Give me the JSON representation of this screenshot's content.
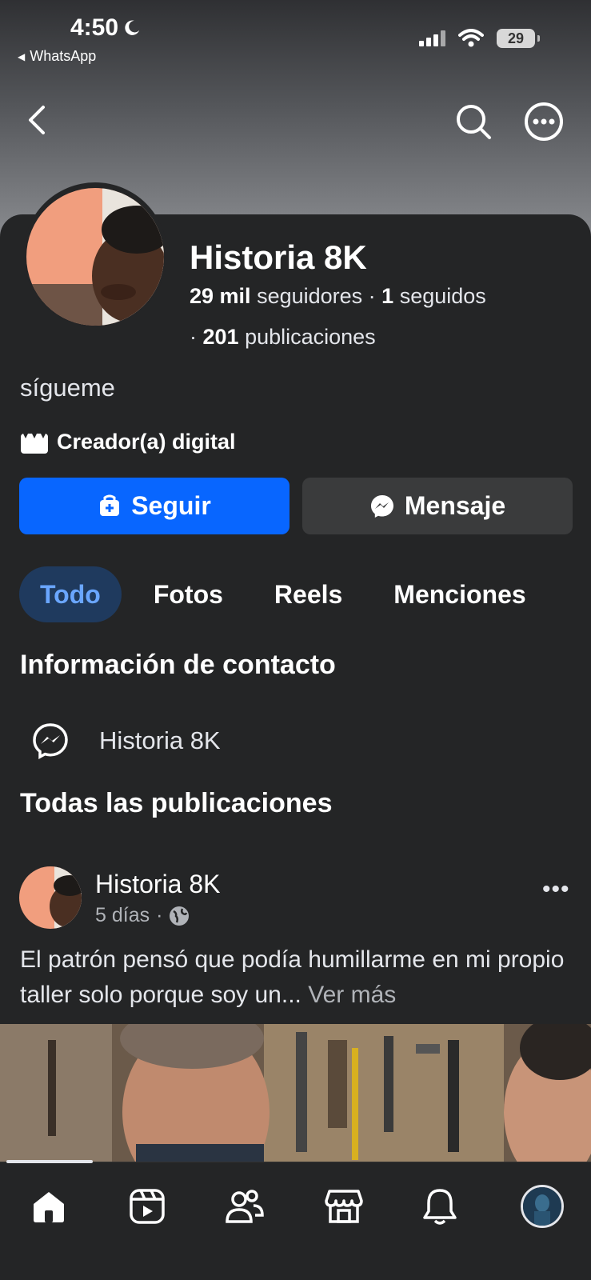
{
  "status_bar": {
    "time": "4:50",
    "back_app": "WhatsApp",
    "battery": "29"
  },
  "profile": {
    "name": "Historia 8K",
    "followers_count": "29 mil",
    "followers_label": "seguidores",
    "following_count": "1",
    "following_label": "seguidos",
    "posts_count": "201",
    "posts_label": "publicaciones",
    "bio": "sígueme",
    "category": "Creador(a) digital"
  },
  "actions": {
    "follow_label": "Seguir",
    "message_label": "Mensaje"
  },
  "tabs": [
    {
      "label": "Todo",
      "active": true
    },
    {
      "label": "Fotos",
      "active": false
    },
    {
      "label": "Reels",
      "active": false
    },
    {
      "label": "Menciones",
      "active": false
    }
  ],
  "contact": {
    "title": "Información de contacto",
    "messenger_name": "Historia 8K"
  },
  "posts_section": {
    "title": "Todas las publicaciones"
  },
  "post": {
    "author": "Historia 8K",
    "time": "5 días",
    "text": "El patrón pensó que podía humillarme en mi propio taller solo porque soy un...",
    "see_more": "Ver más"
  },
  "bottom_nav": [
    {
      "icon": "home-icon",
      "active": true
    },
    {
      "icon": "reels-icon",
      "active": false
    },
    {
      "icon": "friends-icon",
      "active": false
    },
    {
      "icon": "marketplace-icon",
      "active": false
    },
    {
      "icon": "bell-icon",
      "active": false
    },
    {
      "icon": "profile-avatar-icon",
      "active": false
    }
  ],
  "colors": {
    "background": "#242526",
    "accent": "#0866ff",
    "active_tab_bg": "#1f3a5e",
    "active_tab_text": "#6aa6ff"
  }
}
